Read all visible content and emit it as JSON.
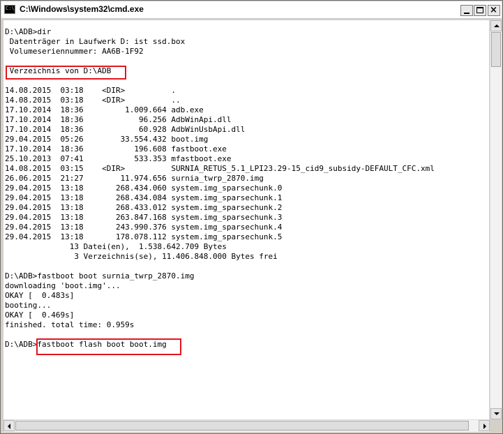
{
  "window": {
    "title": "C:\\Windows\\system32\\cmd.exe",
    "icon_text": "C:\\",
    "buttons": {
      "minimize": "minimize",
      "maximize": "maximize",
      "close": "×"
    }
  },
  "console": {
    "lines": [
      "D:\\ADB>dir",
      " Datenträger in Laufwerk D: ist ssd.box",
      " Volumeseriennummer: AA6B-1F92",
      "",
      " Verzeichnis von D:\\ADB",
      "",
      "14.08.2015  03:18    <DIR>          .",
      "14.08.2015  03:18    <DIR>          ..",
      "17.10.2014  18:36         1.009.664 adb.exe",
      "17.10.2014  18:36            96.256 AdbWinApi.dll",
      "17.10.2014  18:36            60.928 AdbWinUsbApi.dll",
      "29.04.2015  05:26        33.554.432 boot.img",
      "17.10.2014  18:36           196.608 fastboot.exe",
      "25.10.2013  07:41           533.353 mfastboot.exe",
      "14.08.2015  03:15    <DIR>          SURNIA_RETUS_5.1_LPI23.29-15_cid9_subsidy-DEFAULT_CFC.xml",
      "26.06.2015  21:27        11.974.656 surnia_twrp_2870.img",
      "29.04.2015  13:18       268.434.060 system.img_sparsechunk.0",
      "29.04.2015  13:18       268.434.084 system.img_sparsechunk.1",
      "29.04.2015  13:18       268.433.012 system.img_sparsechunk.2",
      "29.04.2015  13:18       263.847.168 system.img_sparsechunk.3",
      "29.04.2015  13:18       243.990.376 system.img_sparsechunk.4",
      "29.04.2015  13:18       178.078.112 system.img_sparsechunk.5",
      "              13 Datei(en),  1.538.642.709 Bytes",
      "               3 Verzeichnis(se), 11.406.848.000 Bytes frei",
      "",
      "D:\\ADB>fastboot boot surnia_twrp_2870.img",
      "downloading 'boot.img'...",
      "OKAY [  0.483s]",
      "booting...",
      "OKAY [  0.469s]",
      "finished. total time: 0.959s",
      "",
      "D:\\ADB>fastboot flash boot boot.img"
    ]
  },
  "highlights": [
    {
      "label": "Verzeichnis von D:\\ADB",
      "color": "#e2161d"
    },
    {
      "label": "fastboot flash boot boot.img",
      "color": "#e2161d"
    }
  ],
  "colors": {
    "console_bg": "#ffffff",
    "console_text": "#000000",
    "highlight": "#e2161d"
  }
}
